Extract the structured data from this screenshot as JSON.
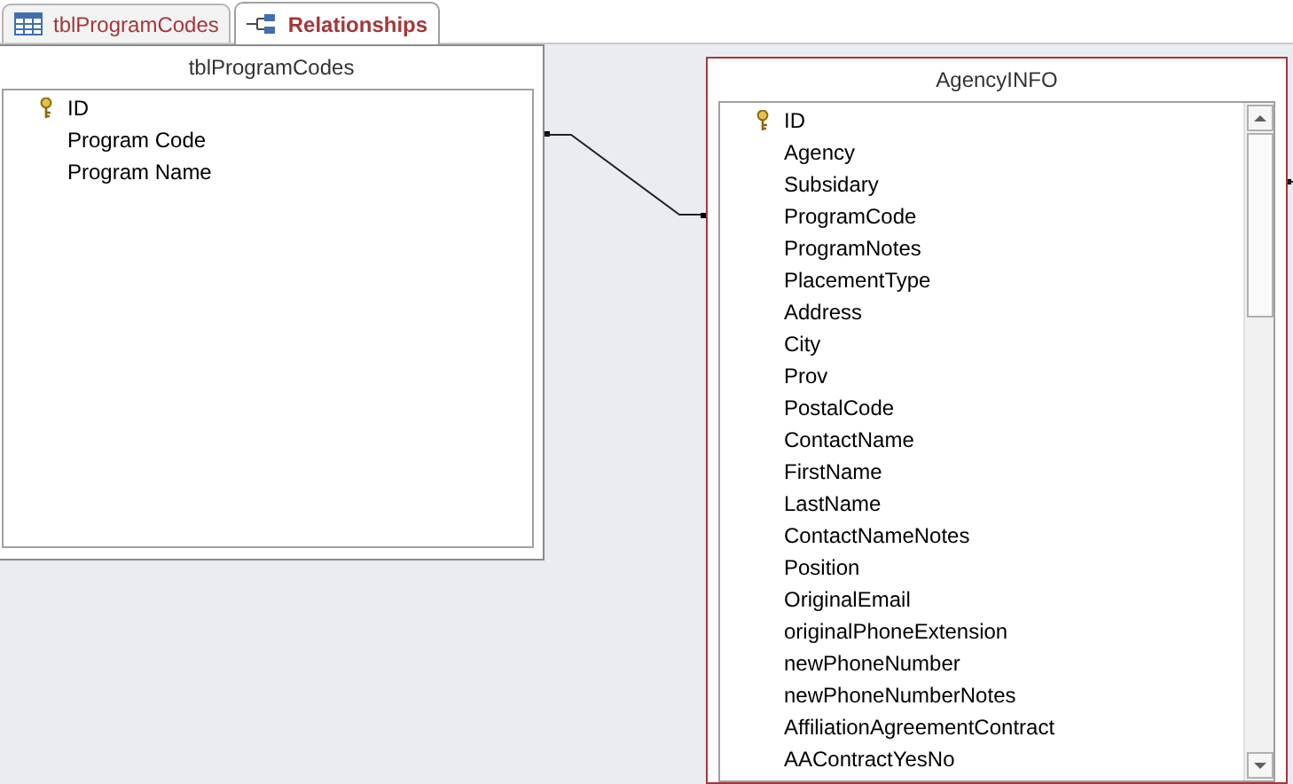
{
  "tabs": [
    {
      "label": "tblProgramCodes",
      "kind": "table",
      "selected": false
    },
    {
      "label": "Relationships",
      "kind": "relationships",
      "selected": true
    }
  ],
  "tables": [
    {
      "title": "tblProgramCodes",
      "selected": false,
      "fields": [
        {
          "name": "ID",
          "primary_key": true
        },
        {
          "name": "Program Code",
          "primary_key": false
        },
        {
          "name": "Program Name",
          "primary_key": false
        }
      ]
    },
    {
      "title": "AgencyINFO",
      "selected": true,
      "fields": [
        {
          "name": "ID",
          "primary_key": true
        },
        {
          "name": "Agency",
          "primary_key": false
        },
        {
          "name": "Subsidary",
          "primary_key": false
        },
        {
          "name": "ProgramCode",
          "primary_key": false
        },
        {
          "name": "ProgramNotes",
          "primary_key": false
        },
        {
          "name": "PlacementType",
          "primary_key": false
        },
        {
          "name": "Address",
          "primary_key": false
        },
        {
          "name": "City",
          "primary_key": false
        },
        {
          "name": "Prov",
          "primary_key": false
        },
        {
          "name": "PostalCode",
          "primary_key": false
        },
        {
          "name": "ContactName",
          "primary_key": false
        },
        {
          "name": "FirstName",
          "primary_key": false
        },
        {
          "name": "LastName",
          "primary_key": false
        },
        {
          "name": "ContactNameNotes",
          "primary_key": false
        },
        {
          "name": "Position",
          "primary_key": false
        },
        {
          "name": "OriginalEmail",
          "primary_key": false
        },
        {
          "name": "originalPhoneExtension",
          "primary_key": false
        },
        {
          "name": "newPhoneNumber",
          "primary_key": false
        },
        {
          "name": "newPhoneNumberNotes",
          "primary_key": false
        },
        {
          "name": "AffiliationAgreementContract",
          "primary_key": false
        },
        {
          "name": "AAContractYesNo",
          "primary_key": false
        }
      ]
    }
  ]
}
